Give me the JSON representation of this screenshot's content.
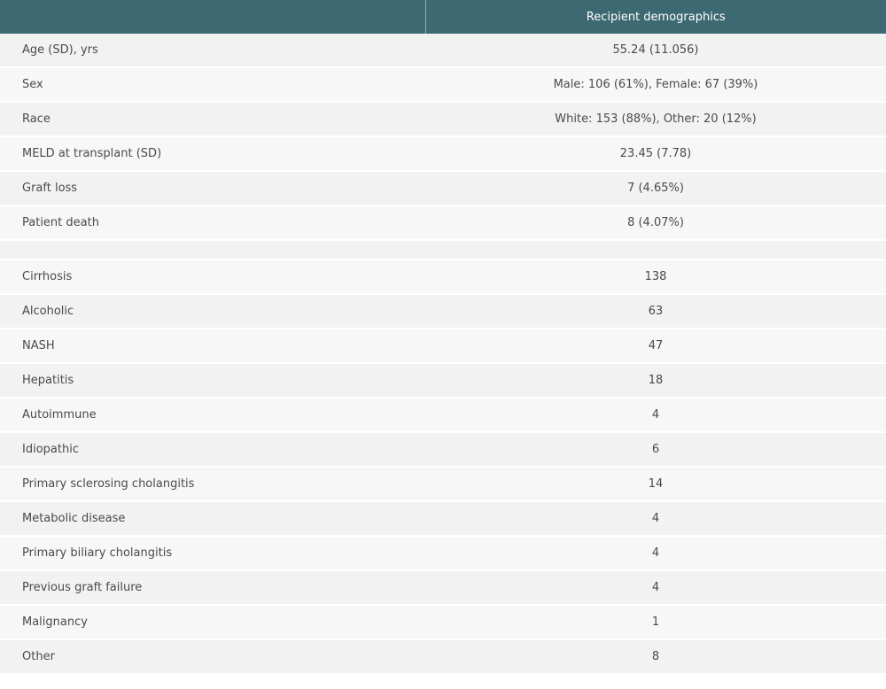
{
  "table": {
    "header": [
      "",
      "Recipient demographics"
    ],
    "rows": [
      {
        "label": "Age (SD), yrs",
        "value": "55.24 (11.056)"
      },
      {
        "label": "Sex",
        "value": "Male: 106 (61%), Female: 67 (39%)"
      },
      {
        "label": "Race",
        "value": "White: 153 (88%), Other: 20 (12%)"
      },
      {
        "label": "MELD at transplant (SD)",
        "value": "23.45 (7.78)"
      },
      {
        "label": "Graft loss",
        "value": "7 (4.65%)"
      },
      {
        "label": "Patient death",
        "value": "8 (4.07%)"
      },
      {
        "label": "",
        "value": ""
      },
      {
        "label": "Cirrhosis",
        "value": "138"
      },
      {
        "label": "Alcoholic",
        "value": "63"
      },
      {
        "label": "NASH",
        "value": "47"
      },
      {
        "label": "Hepatitis",
        "value": "18"
      },
      {
        "label": "Autoimmune",
        "value": "4"
      },
      {
        "label": "Idiopathic",
        "value": "6"
      },
      {
        "label": "Primary sclerosing cholangitis",
        "value": "14"
      },
      {
        "label": "Metabolic disease",
        "value": "4"
      },
      {
        "label": "Primary biliary cholangitis",
        "value": "4"
      },
      {
        "label": "Previous graft failure",
        "value": "4"
      },
      {
        "label": "Malignancy",
        "value": "1"
      },
      {
        "label": "Other",
        "value": "8"
      }
    ]
  },
  "colors": {
    "header_bg": "#3d6a72",
    "row_bg_odd": "#f2f2f2",
    "row_bg_even": "#f7f7f7"
  }
}
